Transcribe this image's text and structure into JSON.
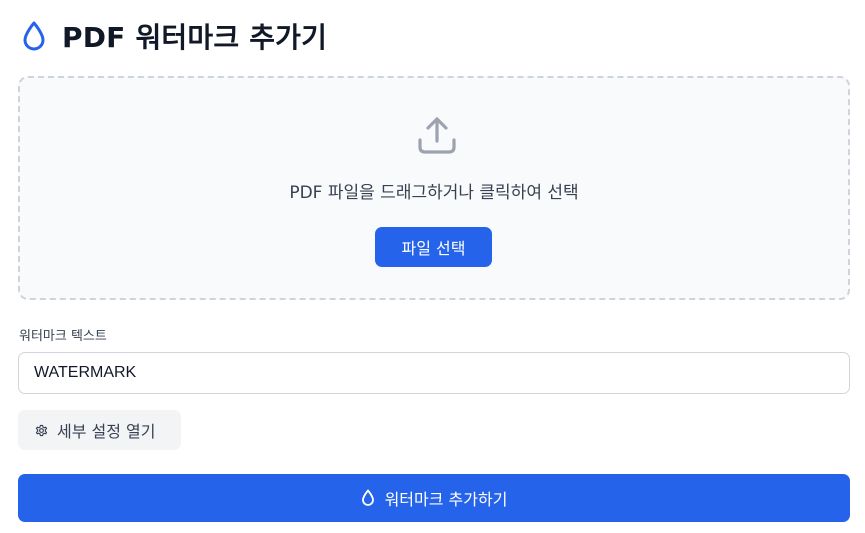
{
  "header": {
    "title": "PDF 워터마크 추가기",
    "icon": "water-drop-icon"
  },
  "dropzone": {
    "icon": "upload-icon",
    "text": "PDF 파일을 드래그하거나 클릭하여 선택",
    "button_label": "파일 선택"
  },
  "watermark": {
    "label": "워터마크 텍스트",
    "value": "WATERMARK"
  },
  "settings": {
    "icon": "gear-icon",
    "button_label": "세부 설정 열기"
  },
  "submit": {
    "icon": "water-drop-icon",
    "label": "워터마크 추가하기"
  },
  "colors": {
    "primary": "#2563eb",
    "text": "#111827",
    "muted_text": "#374151",
    "dropzone_border": "#cfd4dc",
    "dropzone_bg": "#f9fafb",
    "secondary_button_bg": "#f3f4f6"
  }
}
